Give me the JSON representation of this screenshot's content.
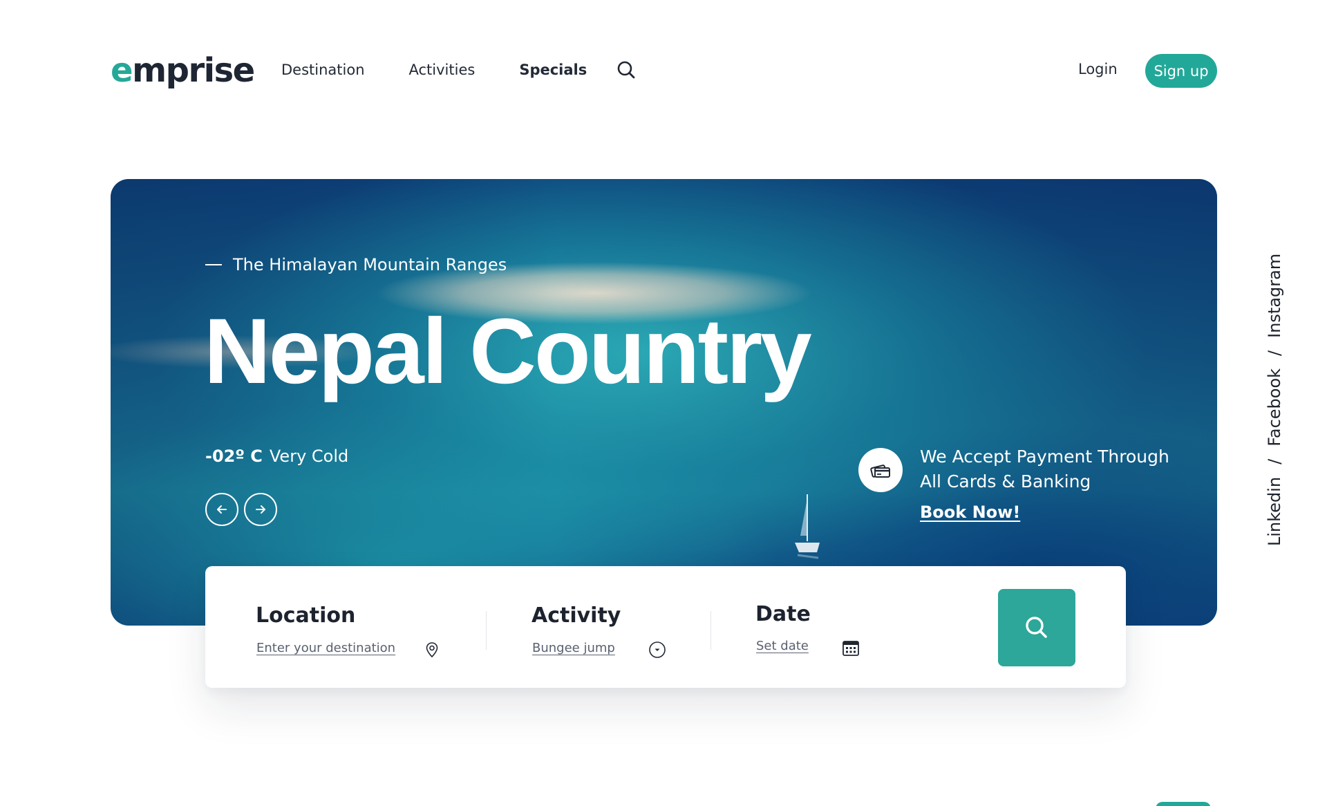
{
  "brand": {
    "logo_first": "e",
    "logo_rest": "mprise",
    "accent_color": "#22a898"
  },
  "nav": {
    "items": [
      {
        "label": "Destination"
      },
      {
        "label": "Activities"
      },
      {
        "label": "Specials"
      }
    ],
    "search_icon": "search-icon"
  },
  "auth": {
    "login": "Login",
    "signup": "Sign up"
  },
  "hero": {
    "eyebrow": "The Himalayan Mountain Ranges",
    "title": "Nepal Country",
    "temperature": "-02º C",
    "condition": "Very Cold",
    "prev_icon": "arrow-left-icon",
    "next_icon": "arrow-right-icon",
    "payment_line1": "We Accept Payment Through",
    "payment_line2": "All Cards & Banking",
    "book_now": "Book Now!",
    "payment_icon": "cards-icon"
  },
  "social": {
    "links": [
      "Linkedin",
      "Facebook",
      "Instagram"
    ],
    "separator": "/"
  },
  "search": {
    "location_label": "Location",
    "location_placeholder": "Enter your destination",
    "activity_label": "Activity",
    "activity_value": "Bungee jump",
    "date_label": "Date",
    "date_placeholder": "Set date",
    "button_icon": "search-icon"
  }
}
